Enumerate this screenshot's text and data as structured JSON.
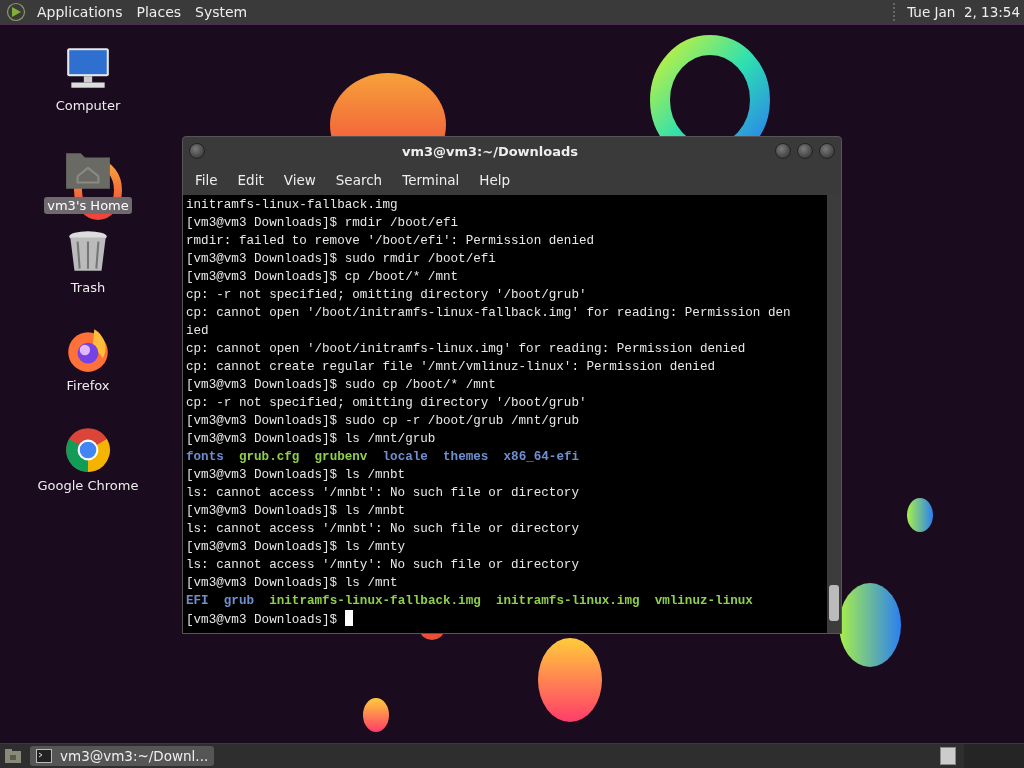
{
  "top_panel": {
    "menus": [
      "Applications",
      "Places",
      "System"
    ],
    "clock": "Tue Jan  2, 13:54"
  },
  "desktop_icons": [
    {
      "kind": "computer",
      "label": "Computer",
      "selected": false
    },
    {
      "kind": "home",
      "label": "vm3's Home",
      "selected": true
    },
    {
      "kind": "trash",
      "label": "Trash",
      "selected": false
    },
    {
      "kind": "firefox",
      "label": "Firefox",
      "selected": false
    },
    {
      "kind": "chrome",
      "label": "Google Chrome",
      "selected": false
    }
  ],
  "terminal": {
    "title": "vm3@vm3:~/Downloads",
    "menu": [
      "File",
      "Edit",
      "View",
      "Search",
      "Terminal",
      "Help"
    ],
    "lines": [
      [
        {
          "kind": "text",
          "text": "initramfs-linux-fallback.img"
        }
      ],
      [
        {
          "kind": "text",
          "text": "[vm3@vm3 Downloads]$ rmdir /boot/efi"
        }
      ],
      [
        {
          "kind": "text",
          "text": "rmdir: failed to remove '/boot/efi': Permission denied"
        }
      ],
      [
        {
          "kind": "text",
          "text": "[vm3@vm3 Downloads]$ sudo rmdir /boot/efi"
        }
      ],
      [
        {
          "kind": "text",
          "text": "[vm3@vm3 Downloads]$ cp /boot/* /mnt"
        }
      ],
      [
        {
          "kind": "text",
          "text": "cp: -r not specified; omitting directory '/boot/grub'"
        }
      ],
      [
        {
          "kind": "text",
          "text": "cp: cannot open '/boot/initramfs-linux-fallback.img' for reading: Permission den"
        }
      ],
      [
        {
          "kind": "text",
          "text": "ied"
        }
      ],
      [
        {
          "kind": "text",
          "text": "cp: cannot open '/boot/initramfs-linux.img' for reading: Permission denied"
        }
      ],
      [
        {
          "kind": "text",
          "text": "cp: cannot create regular file '/mnt/vmlinuz-linux': Permission denied"
        }
      ],
      [
        {
          "kind": "text",
          "text": "[vm3@vm3 Downloads]$ sudo cp /boot/* /mnt"
        }
      ],
      [
        {
          "kind": "text",
          "text": "cp: -r not specified; omitting directory '/boot/grub'"
        }
      ],
      [
        {
          "kind": "text",
          "text": "[vm3@vm3 Downloads]$ sudo cp -r /boot/grub /mnt/grub"
        }
      ],
      [
        {
          "kind": "text",
          "text": "[vm3@vm3 Downloads]$ ls /mnt/grub"
        }
      ],
      [
        {
          "kind": "dir",
          "text": "fonts"
        },
        {
          "kind": "file",
          "text": "grub.cfg"
        },
        {
          "kind": "file",
          "text": "grubenv"
        },
        {
          "kind": "dir",
          "text": "locale"
        },
        {
          "kind": "dir",
          "text": "themes"
        },
        {
          "kind": "dir",
          "text": "x86_64-efi"
        }
      ],
      [
        {
          "kind": "text",
          "text": "[vm3@vm3 Downloads]$ ls /mnbt"
        }
      ],
      [
        {
          "kind": "text",
          "text": "ls: cannot access '/mnbt': No such file or directory"
        }
      ],
      [
        {
          "kind": "text",
          "text": "[vm3@vm3 Downloads]$ ls /mnbt"
        }
      ],
      [
        {
          "kind": "text",
          "text": "ls: cannot access '/mnbt': No such file or directory"
        }
      ],
      [
        {
          "kind": "text",
          "text": "[vm3@vm3 Downloads]$ ls /mnty"
        }
      ],
      [
        {
          "kind": "text",
          "text": "ls: cannot access '/mnty': No such file or directory"
        }
      ],
      [
        {
          "kind": "text",
          "text": "[vm3@vm3 Downloads]$ ls /mnt"
        }
      ],
      [
        {
          "kind": "dir",
          "text": "EFI"
        },
        {
          "kind": "dir",
          "text": "grub"
        },
        {
          "kind": "file",
          "text": "initramfs-linux-fallback.img"
        },
        {
          "kind": "file",
          "text": "initramfs-linux.img"
        },
        {
          "kind": "file",
          "text": "vmlinuz-linux"
        }
      ],
      [
        {
          "kind": "text",
          "text": "[vm3@vm3 Downloads]$ "
        }
      ]
    ]
  },
  "taskbar": {
    "tasks": [
      {
        "label": "vm3@vm3:~/Downl...",
        "selected": true
      }
    ]
  }
}
